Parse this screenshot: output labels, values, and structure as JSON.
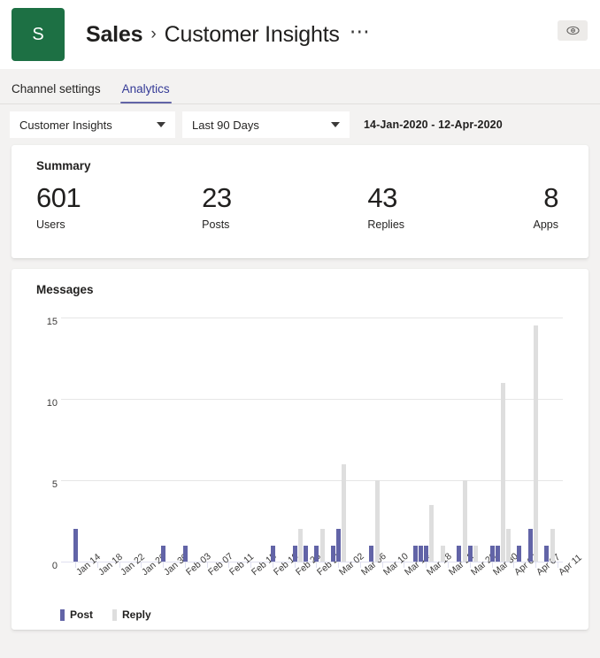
{
  "header": {
    "avatar_initial": "S",
    "avatar_color": "#1d7044",
    "team_name": "Sales",
    "separator": "›",
    "channel_name": "Customer Insights",
    "more_label": "⋯",
    "eye_icon": "eye-icon"
  },
  "tabs": [
    {
      "label": "Channel settings",
      "active": false
    },
    {
      "label": "Analytics",
      "active": true
    }
  ],
  "filters": {
    "channel_select": {
      "value": "Customer Insights",
      "placeholder": "Select channel"
    },
    "period_select": {
      "value": "Last 90 Days",
      "placeholder": "Select period"
    },
    "date_range": "14-Jan-2020 - 12-Apr-2020"
  },
  "summary": {
    "title": "Summary",
    "kpis": [
      {
        "value": "601",
        "label": "Users"
      },
      {
        "value": "23",
        "label": "Posts"
      },
      {
        "value": "43",
        "label": "Replies"
      },
      {
        "value": "8",
        "label": "Apps"
      }
    ]
  },
  "messages": {
    "title": "Messages"
  },
  "colors": {
    "post": "#6264a7",
    "reply": "#dedede",
    "accent": "#6264a7",
    "grid": "#e6e6e6"
  },
  "chart_data": {
    "type": "bar",
    "title": "Messages",
    "xlabel": "",
    "ylabel": "",
    "ylim": [
      0,
      15
    ],
    "yticks": [
      0,
      5,
      10,
      15
    ],
    "grid": true,
    "legend_position": "bottom-left",
    "xtick_labels": [
      "Jan 14",
      "Jan 18",
      "Jan 22",
      "Jan 26",
      "Jan 30",
      "Feb 03",
      "Feb 07",
      "Feb 11",
      "Feb 15",
      "Feb 19",
      "Feb 23",
      "Feb 27",
      "Mar 02",
      "Mar 06",
      "Mar 10",
      "Mar 14",
      "Mar 18",
      "Mar 22",
      "Mar 26",
      "Mar 30",
      "Apr 03",
      "Apr 07",
      "Apr 11"
    ],
    "xtick_step_days": 4,
    "x_start": "Jan 14",
    "x_end": "Apr 12",
    "series": [
      {
        "name": "Post",
        "color": "#6264a7",
        "points": [
          {
            "date": "Jan 14",
            "value": 2
          },
          {
            "date": "Jan 30",
            "value": 1
          },
          {
            "date": "Feb 03",
            "value": 1
          },
          {
            "date": "Feb 19",
            "value": 1
          },
          {
            "date": "Feb 23",
            "value": 1
          },
          {
            "date": "Feb 25",
            "value": 1
          },
          {
            "date": "Feb 27",
            "value": 1
          },
          {
            "date": "Mar 01",
            "value": 1
          },
          {
            "date": "Mar 02",
            "value": 2
          },
          {
            "date": "Mar 08",
            "value": 1
          },
          {
            "date": "Mar 16",
            "value": 1
          },
          {
            "date": "Mar 17",
            "value": 1
          },
          {
            "date": "Mar 18",
            "value": 1
          },
          {
            "date": "Mar 24",
            "value": 1
          },
          {
            "date": "Mar 26",
            "value": 1
          },
          {
            "date": "Mar 30",
            "value": 1
          },
          {
            "date": "Mar 31",
            "value": 1
          },
          {
            "date": "Apr 04",
            "value": 1
          },
          {
            "date": "Apr 06",
            "value": 2
          },
          {
            "date": "Apr 09",
            "value": 1
          }
        ]
      },
      {
        "name": "Reply",
        "color": "#dedede",
        "points": [
          {
            "date": "Feb 24",
            "value": 2
          },
          {
            "date": "Feb 28",
            "value": 2
          },
          {
            "date": "Mar 03",
            "value": 6
          },
          {
            "date": "Mar 09",
            "value": 5
          },
          {
            "date": "Mar 19",
            "value": 3.5
          },
          {
            "date": "Mar 21",
            "value": 1
          },
          {
            "date": "Mar 25",
            "value": 5
          },
          {
            "date": "Mar 27",
            "value": 1
          },
          {
            "date": "Apr 01",
            "value": 11
          },
          {
            "date": "Apr 02",
            "value": 2
          },
          {
            "date": "Apr 07",
            "value": 14.5
          },
          {
            "date": "Apr 10",
            "value": 2
          }
        ]
      }
    ],
    "legend": [
      {
        "label": "Post",
        "color": "#6264a7"
      },
      {
        "label": "Reply",
        "color": "#dedede"
      }
    ]
  }
}
